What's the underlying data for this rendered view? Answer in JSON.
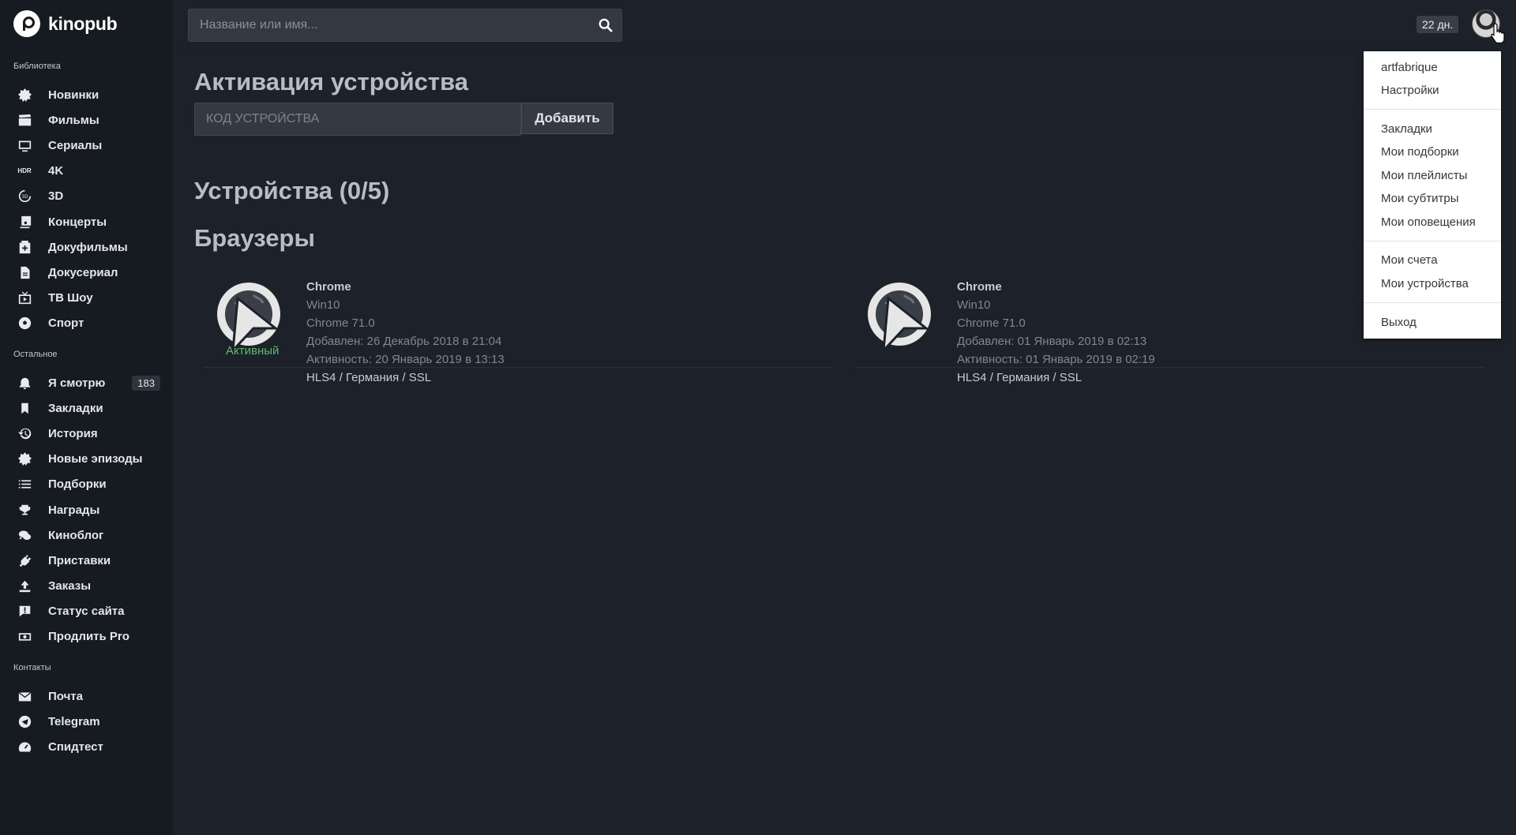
{
  "app": {
    "logo_text": "kinopub"
  },
  "search": {
    "placeholder": "Название или имя..."
  },
  "header": {
    "days_left": "22 дн."
  },
  "sidebar": {
    "library_title": "Библиотека",
    "library_items": [
      {
        "label": "Новинки",
        "icon": "new-icon"
      },
      {
        "label": "Фильмы",
        "icon": "clapperboard-icon"
      },
      {
        "label": "Сериалы",
        "icon": "tv-icon"
      },
      {
        "label": "4K",
        "icon": "hdr-icon"
      },
      {
        "label": "3D",
        "icon": "3d-icon"
      },
      {
        "label": "Концерты",
        "icon": "music-icon"
      },
      {
        "label": "Докуфильмы",
        "icon": "document-box-icon"
      },
      {
        "label": "Докусериал",
        "icon": "document-icon"
      },
      {
        "label": "ТВ Шоу",
        "icon": "tv-show-icon"
      },
      {
        "label": "Спорт",
        "icon": "soccer-ball-icon"
      }
    ],
    "other_title": "Остальное",
    "other_items": [
      {
        "label": "Я смотрю",
        "icon": "bell-icon",
        "badge": "183"
      },
      {
        "label": "Закладки",
        "icon": "bookmark-icon"
      },
      {
        "label": "История",
        "icon": "history-icon"
      },
      {
        "label": "Новые эпизоды",
        "icon": "new-icon"
      },
      {
        "label": "Подборки",
        "icon": "list-icon"
      },
      {
        "label": "Награды",
        "icon": "trophy-icon"
      },
      {
        "label": "Киноблог",
        "icon": "chat-icon"
      },
      {
        "label": "Приставки",
        "icon": "plug-icon"
      },
      {
        "label": "Заказы",
        "icon": "upload-icon"
      },
      {
        "label": "Статус сайта",
        "icon": "alert-icon"
      },
      {
        "label": "Продлить Pro",
        "icon": "money-icon"
      }
    ],
    "contacts_title": "Контакты",
    "contact_items": [
      {
        "label": "Почта",
        "icon": "mail-icon"
      },
      {
        "label": "Telegram",
        "icon": "telegram-icon"
      },
      {
        "label": "Спидтест",
        "icon": "speedometer-icon"
      }
    ]
  },
  "main": {
    "activation_title": "Активация устройства",
    "code_placeholder": "КОД УСТРОЙСТВА",
    "add_button": "Добавить",
    "devices_title": "Устройства (0/5)",
    "browsers_title": "Браузеры",
    "browsers": [
      {
        "name": "Chrome",
        "os": "Win10",
        "version": "Chrome 71.0",
        "added": "Добавлен: 26 Декабрь 2018 в 21:04",
        "activity": "Активность: 20 Январь 2019 в 13:13",
        "tech": "HLS4 / Германия / SSL",
        "status": "Активный"
      },
      {
        "name": "Chrome",
        "os": "Win10",
        "version": "Chrome 71.0",
        "added": "Добавлен: 01 Январь 2019 в 02:13",
        "activity": "Активность: 01 Январь 2019 в 02:19",
        "tech": "HLS4 / Германия / SSL",
        "status": ""
      }
    ]
  },
  "user_menu": {
    "username": "artfabrique",
    "settings": "Настройки",
    "bookmarks": "Закладки",
    "collections": "Мои подборки",
    "playlists": "Мои плейлисты",
    "subtitles": "Мои субтитры",
    "notifications": "Мои оповещения",
    "invoices": "Мои счета",
    "devices": "Мои устройства",
    "logout": "Выход"
  }
}
